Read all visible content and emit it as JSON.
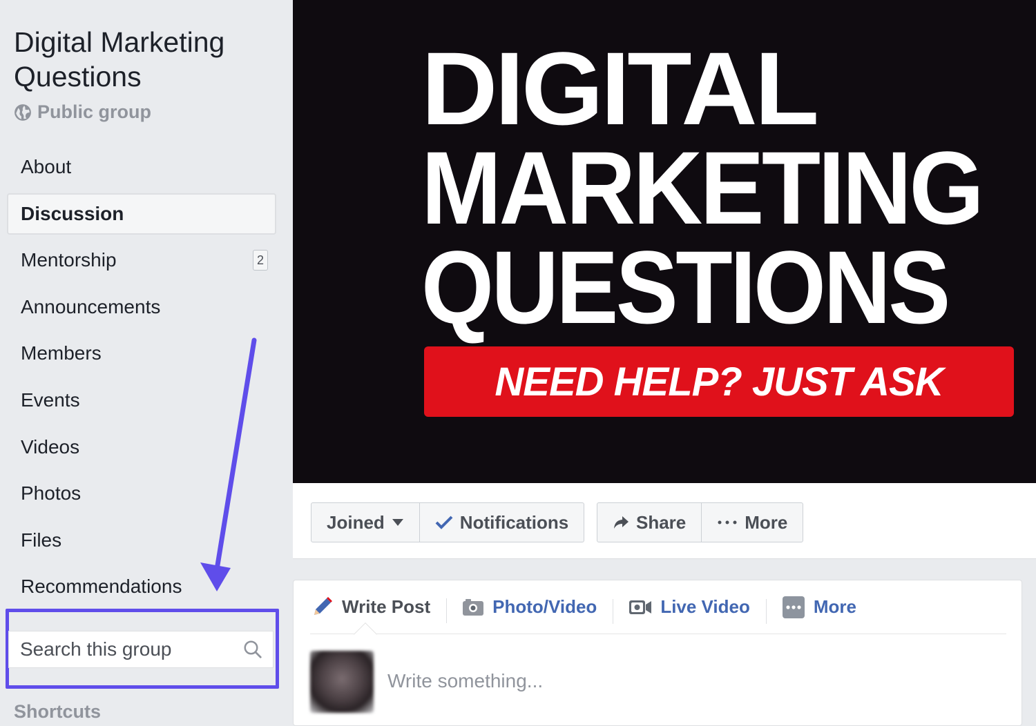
{
  "sidebar": {
    "group_title": "Digital Marketing Questions",
    "privacy": "Public group",
    "items": [
      {
        "label": "About"
      },
      {
        "label": "Discussion"
      },
      {
        "label": "Mentorship",
        "badge": "2"
      },
      {
        "label": "Announcements"
      },
      {
        "label": "Members"
      },
      {
        "label": "Events"
      },
      {
        "label": "Videos"
      },
      {
        "label": "Photos"
      },
      {
        "label": "Files"
      },
      {
        "label": "Recommendations"
      }
    ],
    "search_placeholder": "Search this group",
    "shortcuts_label": "Shortcuts"
  },
  "cover": {
    "line1": "DIGITAL",
    "line2": "MARKETING",
    "line3": "QUESTIONS",
    "tagline": "NEED HELP? JUST ASK"
  },
  "actions": {
    "joined": "Joined",
    "notifications": "Notifications",
    "share": "Share",
    "more": "More"
  },
  "composer": {
    "tabs": {
      "write_post": "Write Post",
      "photo_video": "Photo/Video",
      "live_video": "Live Video",
      "more": "More"
    },
    "placeholder": "Write something..."
  },
  "colors": {
    "highlight": "#5f4dea",
    "link": "#4267b2",
    "cover_band": "#e0111b",
    "check": "#4267b2"
  }
}
